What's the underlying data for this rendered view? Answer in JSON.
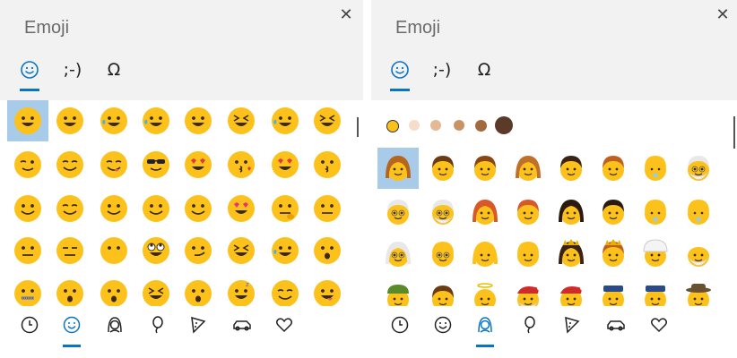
{
  "left_panel": {
    "title": "Emoji",
    "close_glyph": "✕",
    "tabs": [
      {
        "name": "smiley-face-icon",
        "label": ""
      },
      {
        "name": "kaomoji-tab",
        "label": ";-)"
      },
      {
        "name": "symbols-tab",
        "label": "Ω"
      }
    ],
    "active_tab": 0,
    "selected_emoji": 0,
    "emoji_rows": [
      [
        "grinning-face",
        "grinning-big-eyes",
        "joy",
        "rofl",
        "grinning-smile",
        "grinning-squint",
        "sweat-smile",
        "laughing-squint"
      ],
      [
        "winking-face",
        "smiling-blush",
        "yum",
        "sunglasses",
        "heart-eyes",
        "kissing-heart",
        "smiling-hearts",
        "kissing-closed-eyes"
      ],
      [
        "kissing-smiling-eyes",
        "relieved-blush",
        "smiling-face",
        "slightly-smiling",
        "hugging-face",
        "star-struck",
        "thinking-face",
        "neutral-flat"
      ],
      [
        "neutral-face",
        "expressionless",
        "no-mouth",
        "rolling-eyes",
        "smirking-face",
        "persevering-face",
        "sad-sweat",
        "hushed-face"
      ],
      [
        "zipper-mouth",
        "open-mouth",
        "sleepy-face",
        "tired-face",
        "yawning",
        "sleeping-face",
        "relieved-face",
        "tongue-out"
      ]
    ],
    "categories": [
      {
        "name": "clock-icon"
      },
      {
        "name": "smiley-icon"
      },
      {
        "name": "person-icon"
      },
      {
        "name": "balloon-icon"
      },
      {
        "name": "pizza-icon"
      },
      {
        "name": "car-icon"
      },
      {
        "name": "heart-icon"
      }
    ],
    "active_category": 1
  },
  "right_panel": {
    "title": "Emoji",
    "close_glyph": "✕",
    "tabs": [
      {
        "name": "smiley-face-icon",
        "label": ""
      },
      {
        "name": "kaomoji-tab",
        "label": ";-)"
      },
      {
        "name": "symbols-tab",
        "label": "Ω"
      }
    ],
    "active_tab": 0,
    "skin_tones": [
      "#fcc21b",
      "#f6dccb",
      "#e3ba95",
      "#c99365",
      "#a26a3e",
      "#5b3a29"
    ],
    "selected_tone": 0,
    "selected_person": 0,
    "person_rows": [
      [
        "woman",
        "boy",
        "man",
        "girl",
        "man-2",
        "man-3",
        "baby",
        "old-man-beard"
      ],
      [
        "old-man",
        "old-man-white",
        "woman-red",
        "man-red",
        "woman-dark",
        "man-dark",
        "baby-2",
        "baby-3"
      ],
      [
        "old-woman",
        "old-man-bald",
        "woman-blonde",
        "man-blonde",
        "woman-crown",
        "prince",
        "man-turban",
        "man-beard"
      ],
      [
        "person-cap",
        "person-hair",
        "angel",
        "santa",
        "mrs-claus",
        "police-man",
        "police-woman",
        "detective"
      ]
    ],
    "categories": [
      {
        "name": "clock-icon"
      },
      {
        "name": "smiley-icon"
      },
      {
        "name": "person-icon"
      },
      {
        "name": "balloon-icon"
      },
      {
        "name": "pizza-icon"
      },
      {
        "name": "car-icon"
      },
      {
        "name": "heart-icon"
      }
    ],
    "active_category": 2,
    "colors": {
      "emoji_yellow": "#fcc21b",
      "selection": "#a7cbe8",
      "accent": "#0a74c4"
    }
  }
}
